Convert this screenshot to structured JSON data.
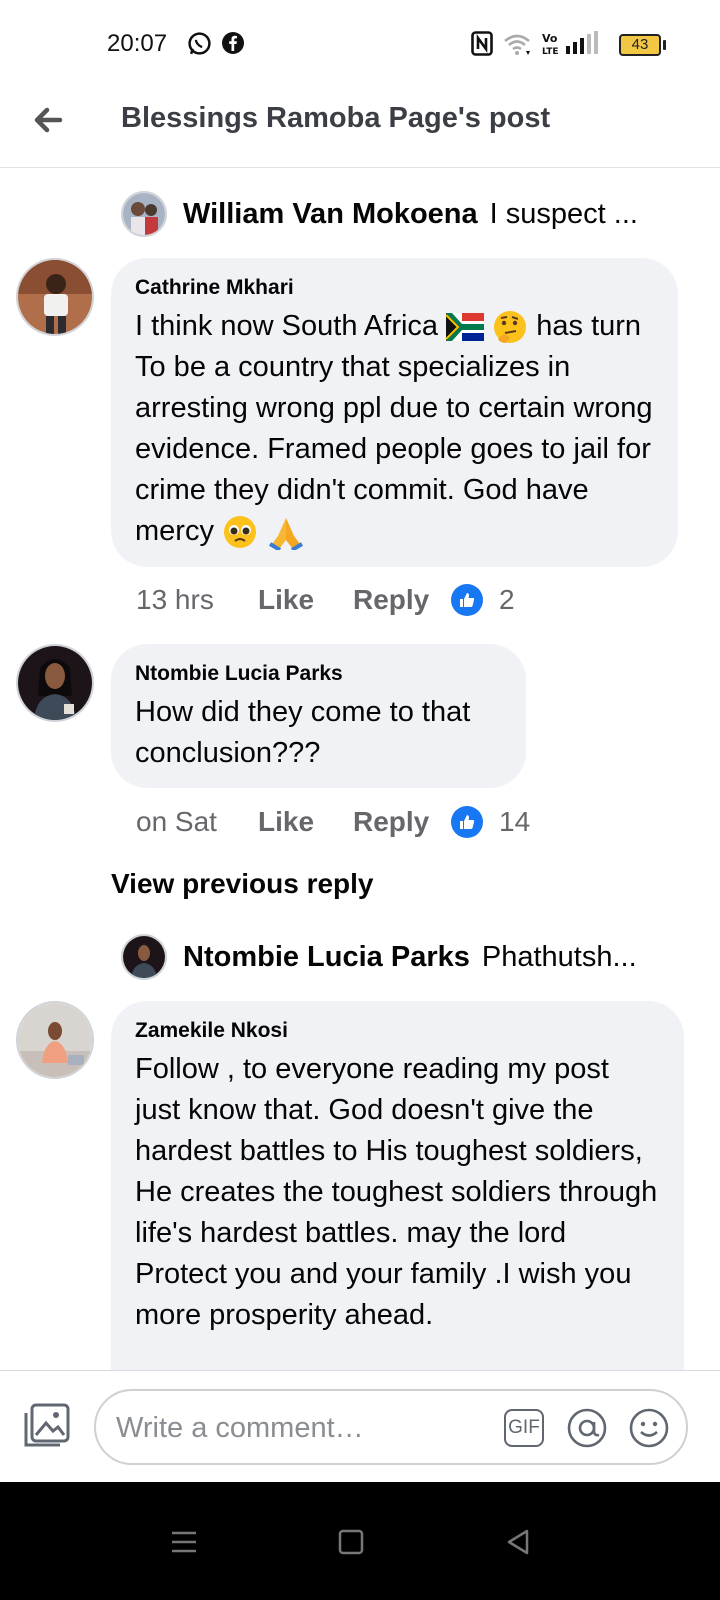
{
  "status_bar": {
    "time": "20:07",
    "battery": "43",
    "icons": [
      "whatsapp-icon",
      "facebook-icon",
      "nfc-icon",
      "wifi-icon",
      "volte-icon",
      "signal-icon",
      "battery-icon"
    ]
  },
  "header": {
    "title": "Blessings Ramoba Page's post",
    "back_icon": "arrow-left-icon"
  },
  "comments": {
    "reply_summary_1": {
      "name": "William Van Mokoena",
      "snippet": "I suspect ..."
    },
    "comment_1": {
      "author": "Cathrine Mkhari",
      "text_1": "I think now South Africa",
      "text_2": "has turn To be a country that specializes in arresting wrong ppl due to certain wrong evidence. Framed people goes to jail for crime they didn't commit. God have mercy",
      "time": "13 hrs",
      "like_label": "Like",
      "reply_label": "Reply",
      "reactions": "2"
    },
    "comment_2": {
      "author": "Ntombie Lucia Parks",
      "text": "How did they come to that conclusion???",
      "time": "on Sat",
      "like_label": "Like",
      "reply_label": "Reply",
      "reactions": "14"
    },
    "view_previous": "View previous reply",
    "reply_summary_2": {
      "name": "Ntombie Lucia Parks",
      "snippet": "Phathutsh..."
    },
    "comment_3": {
      "author": "Zamekile Nkosi",
      "text": "Follow , to everyone  reading my post just know that. God doesn't give the hardest battles to His toughest soldiers, He creates the toughest soldiers through life's hardest battles. may the lord Protect  you and your family .I  wish you more prosperity ahead."
    }
  },
  "composer": {
    "placeholder": "Write a comment…",
    "gif_label": "GIF"
  },
  "colors": {
    "bubble": "#f0f2f5",
    "like_blue": "#1877f2",
    "secondary_text": "#65676b",
    "battery_fill": "#f2c744"
  }
}
